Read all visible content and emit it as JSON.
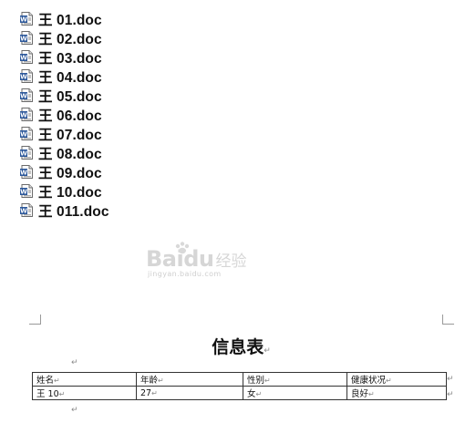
{
  "files": [
    {
      "name": "王 01.doc"
    },
    {
      "name": "王 02.doc"
    },
    {
      "name": "王 03.doc"
    },
    {
      "name": "王 04.doc"
    },
    {
      "name": "王 05.doc"
    },
    {
      "name": "王 06.doc"
    },
    {
      "name": "王 07.doc"
    },
    {
      "name": "王 08.doc"
    },
    {
      "name": "王 09.doc"
    },
    {
      "name": "王 10.doc"
    },
    {
      "name": "王 011.doc"
    }
  ],
  "file_icon": "word-doc-icon",
  "watermark": {
    "logo": "Baidu",
    "sub": "经验",
    "domain": "jingyan.baidu.com"
  },
  "document": {
    "title": "信息表",
    "paragraph_mark": "↵",
    "table": {
      "rows": [
        [
          "姓名",
          "年龄",
          "性别",
          "健康状况"
        ],
        [
          "王 10",
          "27",
          "女",
          "良好"
        ]
      ]
    }
  },
  "colors": {
    "word_blue": "#2b579a",
    "watermark_gray": "#d6d6d6",
    "table_border": "#333333"
  }
}
